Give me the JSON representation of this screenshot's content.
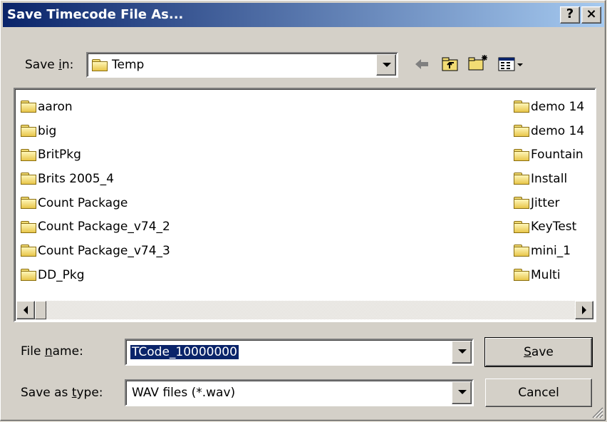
{
  "dialog": {
    "title": "Save Timecode File As...",
    "help_button": "?",
    "close_button": "×"
  },
  "save_in": {
    "label_pre": "Save ",
    "label_accel": "i",
    "label_post": "n:",
    "value": "Temp"
  },
  "toolbar": {
    "back_icon": "back-arrow-icon",
    "up_icon": "up-folder-icon",
    "new_folder_icon": "new-folder-icon",
    "views_icon": "views-menu-icon"
  },
  "files": {
    "left_column": [
      "aaron",
      "big",
      "BritPkg",
      "Brits 2005_4",
      "Count Package",
      "Count Package_v74_2",
      "Count Package_v74_3",
      "DD_Pkg"
    ],
    "right_column": [
      "demo 14",
      "demo 14",
      "Fountain",
      "Install",
      "Jitter",
      "KeyTest",
      "mini_1",
      "Multi"
    ]
  },
  "file_name": {
    "label_pre": "File ",
    "label_accel": "n",
    "label_post": "ame:",
    "value": "TCode_10000000"
  },
  "save_as_type": {
    "label_pre": "Save as ",
    "label_accel": "t",
    "label_post": "ype:",
    "value": "WAV files (*.wav)"
  },
  "buttons": {
    "save_accel": "S",
    "save_rest": "ave",
    "cancel": "Cancel"
  },
  "colors": {
    "title_start": "#0a246a",
    "title_end": "#a6caf0",
    "face": "#d4d0c8",
    "selection": "#0a246a"
  }
}
